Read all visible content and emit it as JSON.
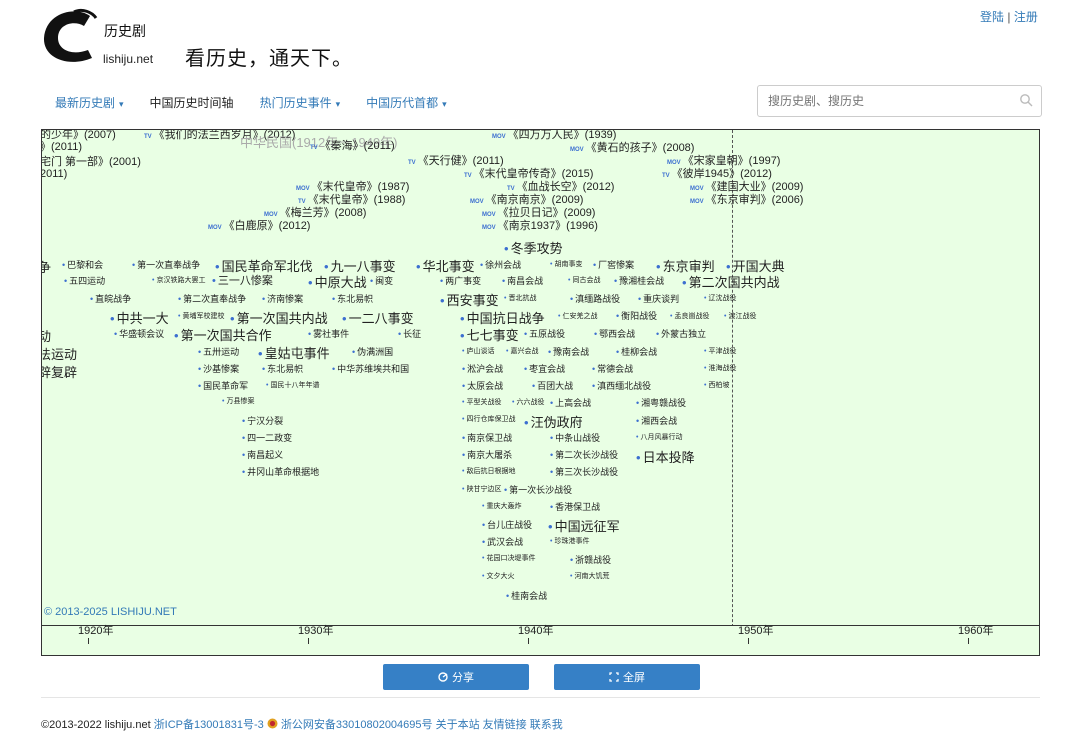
{
  "auth": {
    "login": "登陆",
    "sep": "|",
    "register": "注册"
  },
  "logo": {
    "site": "lishiju.net",
    "glyph": "C",
    "calligraphy": "历史剧"
  },
  "slogan": "看历史，通天下。",
  "nav": [
    {
      "label": "最新历史剧",
      "dropdown": true
    },
    {
      "label": "中国历史时间轴",
      "dropdown": false
    },
    {
      "label": "热门历史事件",
      "dropdown": true
    },
    {
      "label": "中国历代首都",
      "dropdown": true
    }
  ],
  "search": {
    "placeholder": "搜历史剧、搜历史",
    "icon": "search-icon"
  },
  "timeline": {
    "era_label": "中华民国(1912年－1949年)",
    "copyright": "© 2013-2025 LISHIJU.NET",
    "axis_ticks": [
      "1920年",
      "1930年",
      "1940年",
      "1950年",
      "1960年"
    ],
    "media": [
      {
        "tag": "",
        "text": "的少年》(2007)"
      },
      {
        "tag": "",
        "text": "》(2011)"
      },
      {
        "tag": "",
        "text": "宅门 第一部》(2001)"
      },
      {
        "tag": "",
        "text": "2011)"
      },
      {
        "tag": "TV",
        "text": "《我们的法兰西岁月》(2012)"
      },
      {
        "tag": "TV",
        "text": "《秦海》(2011)"
      },
      {
        "tag": "MOV",
        "text": "《四万万人民》(1939)"
      },
      {
        "tag": "MOV",
        "text": "《黄石的孩子》(2008)"
      },
      {
        "tag": "TV",
        "text": "《天行健》(2011)"
      },
      {
        "tag": "MOV",
        "text": "《宋家皇朝》(1997)"
      },
      {
        "tag": "TV",
        "text": "《末代皇帝传奇》(2015)"
      },
      {
        "tag": "TV",
        "text": "《彼岸1945》(2012)"
      },
      {
        "tag": "MOV",
        "text": "《末代皇帝》(1987)"
      },
      {
        "tag": "TV",
        "text": "《血战长空》(2012)"
      },
      {
        "tag": "MOV",
        "text": "《建国大业》(2009)"
      },
      {
        "tag": "TV",
        "text": "《末代皇帝》(1988)"
      },
      {
        "tag": "MOV",
        "text": "《南京南京》(2009)"
      },
      {
        "tag": "MOV",
        "text": "《东京审判》(2006)"
      },
      {
        "tag": "MOV",
        "text": "《梅兰芳》(2008)"
      },
      {
        "tag": "MOV",
        "text": "《拉贝日记》(2009)"
      },
      {
        "tag": "MOV",
        "text": "《白鹿原》(2012)"
      },
      {
        "tag": "MOV",
        "text": "《南京1937》(1996)"
      }
    ],
    "events": [
      "冬季攻势",
      "争",
      "巴黎和会",
      "第一次直奉战争",
      "国民革命军北伐",
      "九一八事变",
      "华北事变",
      "徐州会战",
      "胡南事变",
      "厂窖惨案",
      "东京审判",
      "开国大典",
      "五四运动",
      "京汉铁路大罢工",
      "三一八惨案",
      "中原大战",
      "闽变",
      "两广事变",
      "南昌会战",
      "同古会战",
      "豫湘桂会战",
      "第二次国共内战",
      "直皖战争",
      "第二次直奉战争",
      "济南惨案",
      "东北易帜",
      "西安事变",
      "晋北抗战",
      "滇缅路战役",
      "重庆谈判",
      "辽沈战役",
      "中共一大",
      "黄埔军校建校",
      "第一次国共内战",
      "一二八事变",
      "中国抗日战争",
      "仁安羌之战",
      "衡阳战役",
      "孟良崮战役",
      "渡江战役",
      "动",
      "华盛顿会议",
      "第一次国共合作",
      "雾社事件",
      "长征",
      "七七事变",
      "五原战役",
      "鄂西会战",
      "外蒙古独立",
      "法运动",
      "五卅运动",
      "皇姑屯事件",
      "伪满洲国",
      "庐山谈话",
      "嘉兴会战",
      "豫南会战",
      "桂柳会战",
      "平津战役",
      "辟复辟",
      "沙基惨案",
      "东北易帜",
      "中华苏维埃共和国",
      "淞沪会战",
      "枣宜会战",
      "常德会战",
      "淮海战役",
      "国民革命军",
      "国民十八年年谱",
      "太原会战",
      "百团大战",
      "滇西缅北战役",
      "西柏坡",
      "万县惨案",
      "平型关战役",
      "六六战役",
      "上高会战",
      "湘粤赣战役",
      "宁汉分裂",
      "四行仓库保卫战",
      "汪伪政府",
      "湘西会战",
      "四一二政变",
      "南京保卫战",
      "中条山战役",
      "八月风暴行动",
      "南昌起义",
      "南京大屠杀",
      "第二次长沙战役",
      "日本投降",
      "井冈山革命根据地",
      "敌后抗日根据地",
      "第三次长沙战役",
      "陕甘宁边区",
      "第一次长沙战役",
      "重庆大轰炸",
      "香港保卫战",
      "台儿庄战役",
      "中国远征军",
      "武汉会战",
      "珍珠港事件",
      "花园口决堤事件",
      "浙赣战役",
      "文夕大火",
      "河南大饥荒",
      "桂南会战"
    ]
  },
  "buttons": {
    "share": "分享",
    "fullscreen": "全屏"
  },
  "footer": {
    "copyright": "©2013-2022 lishiju.net",
    "icp": "浙ICP备13001831号-3",
    "police": "浙公网安备33010802004695号",
    "about": "关于本站",
    "links": "友情链接",
    "contact": "联系我"
  }
}
